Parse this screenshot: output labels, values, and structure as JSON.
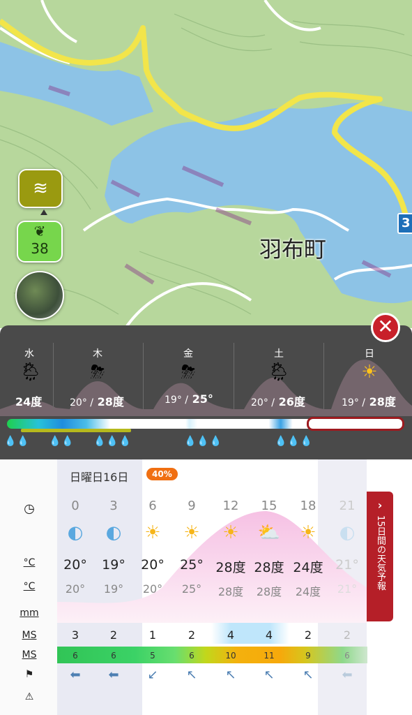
{
  "map": {
    "place_label": "羽布町",
    "road_sign": "3",
    "wind_icon": "wind-icon",
    "aqi": {
      "icon": "leaf-icon",
      "value": "38"
    },
    "photo": "webcam-photo"
  },
  "daily": {
    "days": [
      {
        "name": "水",
        "temp": "24度",
        "low": "",
        "icon": "sun-rain-cloud"
      },
      {
        "name": "木",
        "low": "20° /",
        "temp": "28度",
        "icon": "thunder-sun-cloud"
      },
      {
        "name": "金",
        "low": "19° /",
        "temp": "25°",
        "icon": "thunder-sun-cloud"
      },
      {
        "name": "土",
        "low": "20° /",
        "temp": "26度",
        "icon": "sun-rain-cloud"
      },
      {
        "name": "日",
        "low": "19° /",
        "temp": "28度",
        "icon": "sun"
      }
    ],
    "drops": [
      "💧💧",
      "💧💧",
      "💧💧💧",
      "💧💧💧",
      "💧💧💧"
    ]
  },
  "hourly": {
    "date": "日曜日16日",
    "precip_badge": "40%",
    "row_labels": {
      "time": "clock-icon",
      "temp": "°C",
      "feels": "°C",
      "rain": "mm",
      "wind": "MS",
      "gust": "MS",
      "dir": "wind-direction-icon",
      "warn": "warning-icon"
    },
    "hours": [
      "0",
      "3",
      "6",
      "9",
      "12",
      "15",
      "18",
      "21"
    ],
    "icons": [
      "🌒",
      "🌒",
      "☀",
      "☀",
      "☀",
      "⛅",
      "☀",
      "🌒"
    ],
    "temps": [
      "20°",
      "19°",
      "20°",
      "25°",
      "28度",
      "28度",
      "24度",
      "21°"
    ],
    "feels": [
      "20°",
      "19°",
      "20°",
      "25°",
      "28度",
      "28度",
      "24度",
      "21°"
    ],
    "wind": [
      "3",
      "2",
      "1",
      "2",
      "4",
      "4",
      "2",
      "2"
    ],
    "gusts": [
      "6",
      "6",
      "5",
      "6",
      "10",
      "11",
      "9",
      "6"
    ],
    "dirs": [
      "⬅",
      "⬅",
      "↙",
      "↖",
      "↖",
      "↖",
      "↖",
      "⬅"
    ],
    "side_tab": "15日間の天気予報",
    "side_chev": "›"
  },
  "close_label": "✕",
  "colors": {
    "accent_red": "#b51f28",
    "badge_orange": "#f06f12"
  }
}
